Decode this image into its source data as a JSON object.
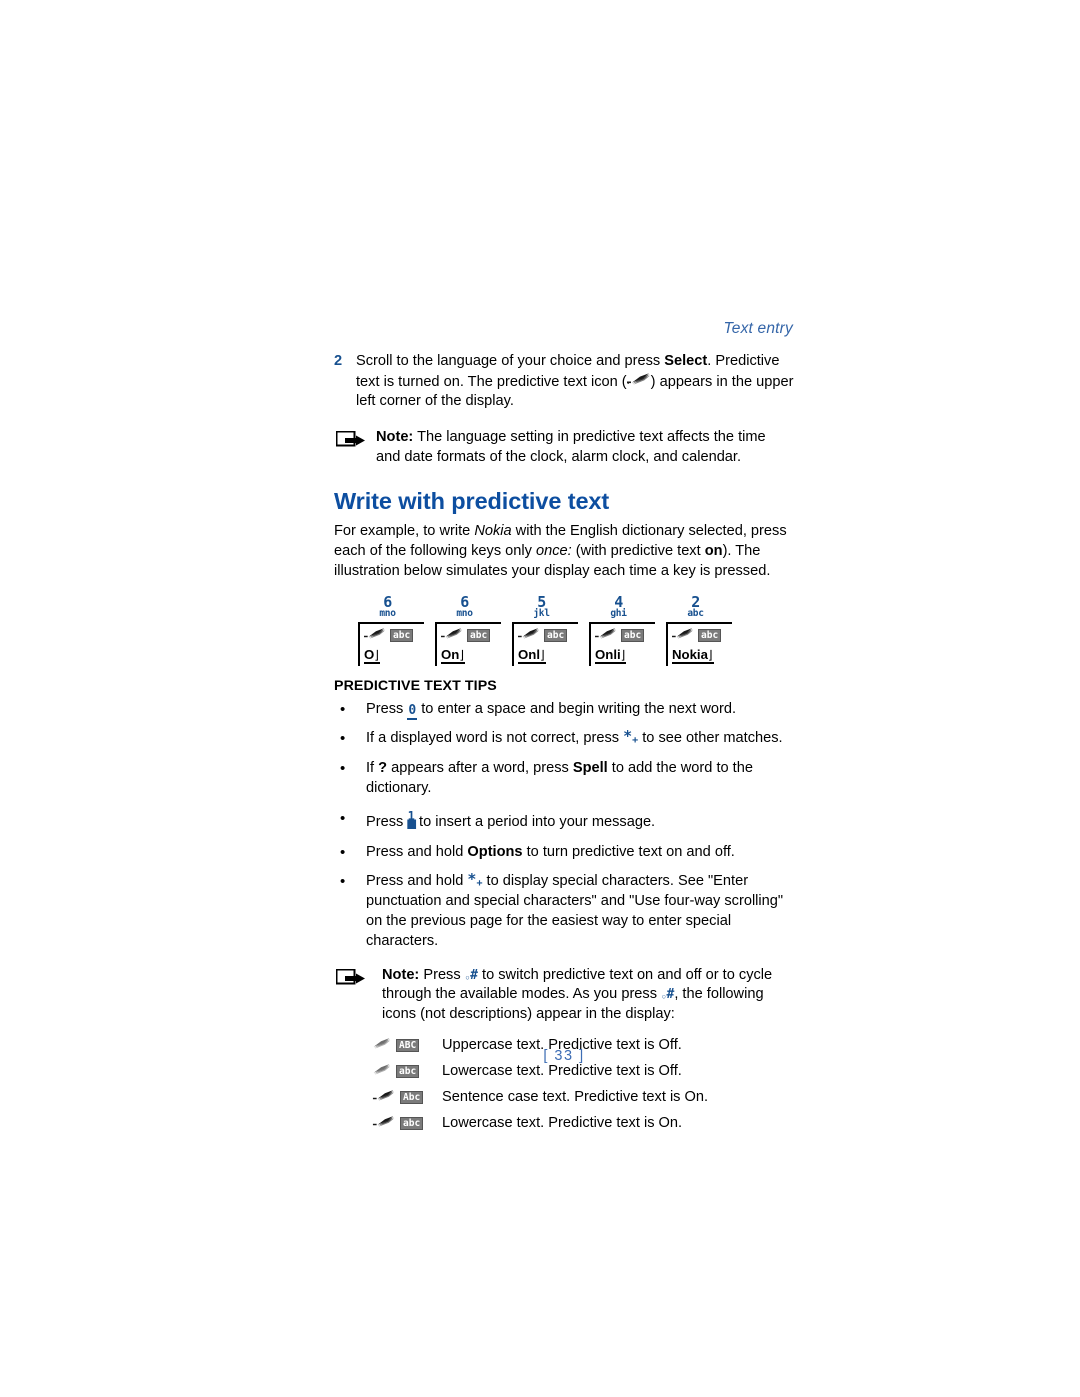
{
  "document": {
    "running_header": "Text entry",
    "page_number": "[ 33 ]"
  },
  "step2": {
    "number": "2",
    "text_part1": "Scroll to the language of your choice and press ",
    "bold1": "Select",
    "text_part2": ". Predictive text is turned on. The predictive text icon (",
    "text_part3": ") appears in the upper left corner of the display."
  },
  "note1": {
    "label": "Note:",
    "text": " The language setting in predictive text affects the time and date formats of the clock, alarm clock, and calendar."
  },
  "section": {
    "title": "Write with predictive text",
    "intro_part1": "For example, to write ",
    "intro_italic1": "Nokia",
    "intro_part2": " with the English dictionary selected, press each of the following keys only ",
    "intro_italic2": "once:",
    "intro_part3": " (with predictive text ",
    "intro_bold1": "on",
    "intro_part4": "). The illustration below simulates your display each time a key is pressed."
  },
  "keystrip": [
    {
      "digit": "6",
      "letters": "mno",
      "word": "O",
      "abc": "abc"
    },
    {
      "digit": "6",
      "letters": "mno",
      "word": "On",
      "abc": "abc"
    },
    {
      "digit": "5",
      "letters": "jkl",
      "word": "Onl",
      "abc": "abc"
    },
    {
      "digit": "4",
      "letters": "ghi",
      "word": "Onli",
      "abc": "abc"
    },
    {
      "digit": "2",
      "letters": "abc",
      "word": "Nokia",
      "abc": "abc"
    }
  ],
  "tips": {
    "title": "PREDICTIVE TEXT TIPS",
    "items": [
      {
        "before": "Press ",
        "glyph": "0",
        "after": " to enter a space and begin writing the next word."
      },
      {
        "before": "If a displayed word is not correct, press ",
        "glyph": "star",
        "after": " to see other matches."
      },
      {
        "before": "If ",
        "bold_mid": "?",
        "mid": " appears after a word, press ",
        "bold2": "Spell",
        "after": " to add the word to the dictionary."
      },
      {
        "before": "Press ",
        "glyph": "1",
        "after": " to insert a period into your message."
      },
      {
        "before": "Press and hold ",
        "bold2": "Options",
        "after": " to turn predictive text on and off."
      },
      {
        "before": "Press and hold ",
        "glyph": "star",
        "after": " to display special characters. See \"Enter punctuation and special characters\" and \"Use four-way scrolling\" on the previous page for the easiest way to enter special characters."
      }
    ]
  },
  "note2": {
    "label": "Note:",
    "part1": " Press ",
    "part2": " to switch predictive text on and off or to cycle through the available modes. As you press ",
    "part3": ", the following icons (not descriptions) appear in the display:"
  },
  "legend": [
    {
      "predictive": "off",
      "box": "ABC",
      "text": "Uppercase text. Predictive text is Off."
    },
    {
      "predictive": "off",
      "box": "abc",
      "text": "Lowercase text. Predictive text is Off."
    },
    {
      "predictive": "on",
      "box": "Abc",
      "text": "Sentence case text. Predictive text is On."
    },
    {
      "predictive": "on",
      "box": "abc",
      "text": "Lowercase text. Predictive text is On."
    }
  ],
  "colors": {
    "heading_blue": "#0d4ea0",
    "header_blue": "#3465a8",
    "key_blue": "#17508f",
    "page_number_blue": "#3d6db4",
    "abc_box_gray": "#7b7b7b"
  },
  "icons": {
    "note_marker": "square-arrow-icon",
    "predictive_text": "predictive-text-swoosh-icon",
    "char_case_box": "abc-case-box-icon"
  }
}
